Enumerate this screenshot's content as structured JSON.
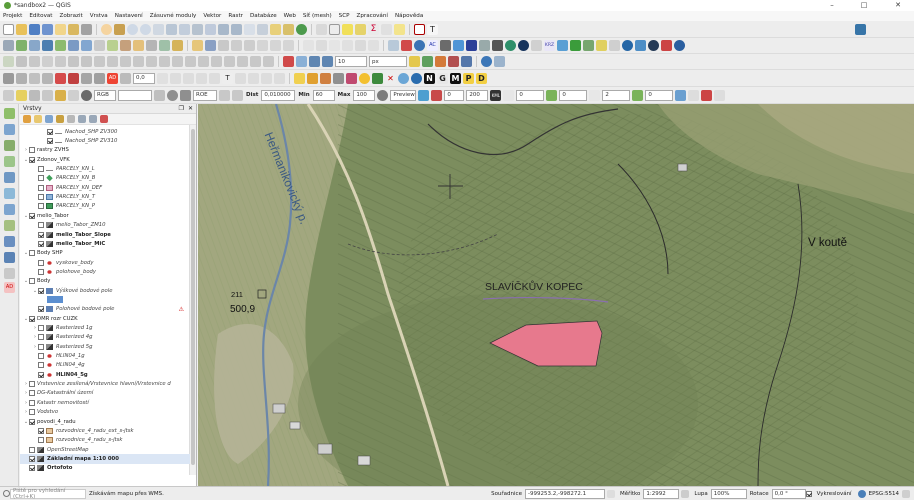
{
  "window": {
    "title": "*sandbox2 — QGIS",
    "minimize": "–",
    "maximize": "□",
    "close": "✕"
  },
  "menu": [
    "Projekt",
    "Editovat",
    "Zobrazit",
    "Vrstva",
    "Nastavení",
    "Zásuvné moduly",
    "Vektor",
    "Rastr",
    "Databáze",
    "Web",
    "Síť (mesh)",
    "SCP",
    "Zpracování",
    "Nápověda"
  ],
  "toolbar": {
    "snap_tolerance": "10",
    "snap_unit": "px",
    "rotation_field": "0,0",
    "raster_band": "RGB",
    "roe_label": "ROE",
    "dist_label": "Dist",
    "dist_value": "0,010000",
    "min_label": "Min",
    "min_value": "60",
    "max_label": "Max",
    "max_value": "100",
    "preview_label": "Preview",
    "range_from": "0",
    "range_to": "200",
    "kml_label": "KML",
    "v0": "0",
    "v1": "0",
    "v2": "2",
    "v3": "0",
    "text_tool": "T",
    "krz_label": "KRZ",
    "ac_label": "AC",
    "ngmp_labels": [
      "N",
      "G",
      "M",
      "P",
      "D"
    ]
  },
  "panel": {
    "title": "Vrstvy"
  },
  "layers": [
    {
      "indent": 2,
      "arrow": "",
      "checked": true,
      "label": "Nachod_SHP ZV300",
      "style": "it",
      "sym": "line-gray"
    },
    {
      "indent": 2,
      "arrow": "",
      "checked": true,
      "label": "Nachod_SHP ZV310",
      "style": "it",
      "sym": "line-gray"
    },
    {
      "indent": 0,
      "arrow": "›",
      "checked": false,
      "label": "rastry ZVHS",
      "style": "",
      "sym": ""
    },
    {
      "indent": 0,
      "arrow": "⌄",
      "checked": true,
      "label": "Zdonov_VFK",
      "style": "",
      "sym": ""
    },
    {
      "indent": 1,
      "arrow": "",
      "checked": false,
      "label": "PARCELY_KN_L",
      "style": "it",
      "sym": "line-gray"
    },
    {
      "indent": 1,
      "arrow": "",
      "checked": false,
      "label": "PARCELY_KN_B",
      "style": "it",
      "sym": "dia-green"
    },
    {
      "indent": 1,
      "arrow": "",
      "checked": false,
      "label": "PARCELY_KN_DEF",
      "style": "it",
      "sym": "poly-pink"
    },
    {
      "indent": 1,
      "arrow": "",
      "checked": false,
      "label": "PARCELY_KN_T",
      "style": "it",
      "sym": "poly-blue"
    },
    {
      "indent": 1,
      "arrow": "",
      "checked": false,
      "label": "PARCELY_KN_P",
      "style": "it",
      "sym": "poly-green"
    },
    {
      "indent": 0,
      "arrow": "⌄",
      "checked": true,
      "label": "melio_Tabor",
      "style": "",
      "sym": ""
    },
    {
      "indent": 1,
      "arrow": "",
      "checked": false,
      "label": "melio_Tabor_ZM10",
      "style": "it",
      "sym": "raster"
    },
    {
      "indent": 1,
      "arrow": "",
      "checked": true,
      "label": "melio_Tabor_Slope",
      "style": "bd",
      "sym": "raster"
    },
    {
      "indent": 1,
      "arrow": "",
      "checked": true,
      "label": "melio_Tabor_MiC",
      "style": "bd",
      "sym": "raster"
    },
    {
      "indent": 0,
      "arrow": "⌄",
      "checked": false,
      "label": "Body SHP",
      "style": "",
      "sym": ""
    },
    {
      "indent": 1,
      "arrow": "",
      "checked": false,
      "label": "vyskove_body",
      "style": "it",
      "sym": "dot"
    },
    {
      "indent": 1,
      "arrow": "",
      "checked": false,
      "label": "polohove_body",
      "style": "it",
      "sym": "dot"
    },
    {
      "indent": 0,
      "arrow": "⌄",
      "checked": false,
      "label": "Body",
      "style": "",
      "sym": ""
    },
    {
      "indent": 1,
      "arrow": "⌄",
      "checked": true,
      "label": "Výškové bodové pole",
      "style": "it",
      "sym": "wms"
    },
    {
      "indent": 2,
      "arrow": "",
      "checked": false,
      "label": "",
      "style": "",
      "sym": "wmsleg"
    },
    {
      "indent": 1,
      "arrow": "",
      "checked": true,
      "label": "Polohové bodové pole",
      "style": "it",
      "sym": "wms",
      "warn": true
    },
    {
      "indent": 0,
      "arrow": "⌄",
      "checked": true,
      "label": "DMR rozr CUZK",
      "style": "",
      "sym": ""
    },
    {
      "indent": 1,
      "arrow": "›",
      "checked": false,
      "label": "Rasterized 1g",
      "style": "it",
      "sym": "raster"
    },
    {
      "indent": 1,
      "arrow": "›",
      "checked": false,
      "label": "Rasterized 4g",
      "style": "it",
      "sym": "raster"
    },
    {
      "indent": 1,
      "arrow": "›",
      "checked": false,
      "label": "Rasterized 5g",
      "style": "it",
      "sym": "raster"
    },
    {
      "indent": 1,
      "arrow": "",
      "checked": false,
      "label": "HLIN04_1g",
      "style": "it",
      "sym": "dot"
    },
    {
      "indent": 1,
      "arrow": "",
      "checked": false,
      "label": "HLIN04_4g",
      "style": "it",
      "sym": "dot"
    },
    {
      "indent": 1,
      "arrow": "",
      "checked": true,
      "label": "HLIN04_5g",
      "style": "bd",
      "sym": "dot"
    },
    {
      "indent": 0,
      "arrow": "›",
      "checked": false,
      "label": "Vrstevnice zesílená/Vrstevnice hlavní/Vrstevnice d",
      "style": "it",
      "sym": ""
    },
    {
      "indent": 0,
      "arrow": "›",
      "checked": false,
      "label": "DG-Katastrální území",
      "style": "it",
      "sym": ""
    },
    {
      "indent": 0,
      "arrow": "›",
      "checked": false,
      "label": "Katastr nemovitostí",
      "style": "it",
      "sym": ""
    },
    {
      "indent": 0,
      "arrow": "›",
      "checked": false,
      "label": "Vodstvo",
      "style": "it",
      "sym": ""
    },
    {
      "indent": 0,
      "arrow": "⌄",
      "checked": true,
      "label": "povodi_4_radu",
      "style": "",
      "sym": ""
    },
    {
      "indent": 1,
      "arrow": "",
      "checked": true,
      "label": "rozvodnice_4_radu_ext_s-jtsk",
      "style": "it",
      "sym": "poly-tan"
    },
    {
      "indent": 1,
      "arrow": "",
      "checked": false,
      "label": "rozvodnice_4_radu_s-jtsk",
      "style": "it",
      "sym": "poly-tan"
    },
    {
      "indent": 0,
      "arrow": "",
      "checked": false,
      "label": "OpenStreetMap",
      "style": "it",
      "sym": "raster"
    },
    {
      "indent": 0,
      "arrow": "",
      "checked": true,
      "label": "Základní mapa 1:10 000",
      "style": "bd",
      "sym": "raster",
      "selected": true
    },
    {
      "indent": 0,
      "arrow": "",
      "checked": true,
      "label": "Ortofoto",
      "style": "bd",
      "sym": "raster"
    }
  ],
  "map": {
    "label_street": "Heřmanikovický p.",
    "label_hill": "SLAVÍČKŮV KOPEC",
    "label_place": "V koutě",
    "label_spot_id": "211",
    "label_spot_elev": "500,9",
    "polygon_color": "#e7798d",
    "water_color": "#6b86a8"
  },
  "status": {
    "search_placeholder": "Piště pro vyhledání (Ctrl+K)",
    "message": "Získávám mapu přes WMS.",
    "coord_label": "Souřadnice",
    "coord_value": "-999253.2,-998272.1",
    "scale_label": "Měřítko",
    "scale_value": "1:2992",
    "magnifier_label": "Lupa",
    "magnifier_value": "100%",
    "rotation_label": "Rotace",
    "rotation_value": "0,0 °",
    "render_label": "Vykreslování",
    "crs": "EPSG:5514"
  }
}
